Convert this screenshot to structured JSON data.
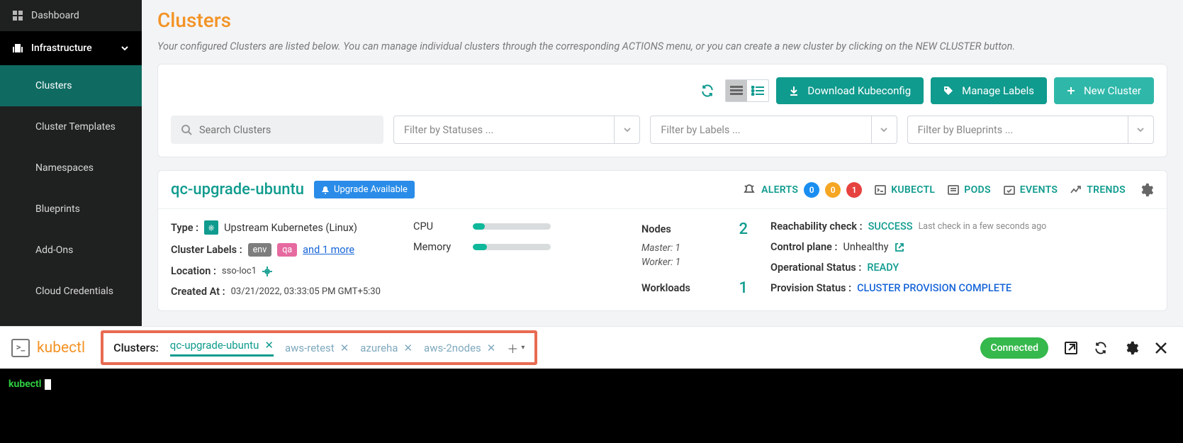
{
  "sidebar": {
    "dashboard": "Dashboard",
    "infrastructure": "Infrastructure",
    "items": [
      "Clusters",
      "Cluster Templates",
      "Namespaces",
      "Blueprints",
      "Add-Ons",
      "Cloud Credentials"
    ]
  },
  "page": {
    "title": "Clusters",
    "description": "Your configured Clusters are listed below. You can manage individual clusters through the corresponding ACTIONS menu, or you can create a new cluster by clicking on the NEW CLUSTER button."
  },
  "toolbar": {
    "download": "Download Kubeconfig",
    "manage_labels": "Manage Labels",
    "new_cluster": "New Cluster",
    "search_placeholder": "Search Clusters",
    "filter_status": "Filter by Statuses ...",
    "filter_labels": "Filter by Labels ...",
    "filter_blueprints": "Filter by Blueprints ..."
  },
  "cluster": {
    "name": "qc-upgrade-ubuntu",
    "upgrade_text": "Upgrade Available",
    "header": {
      "alerts_label": "ALERTS",
      "alerts": {
        "blue": "0",
        "orange": "0",
        "red": "1"
      },
      "links": {
        "kubectl": "KUBECTL",
        "pods": "PODS",
        "events": "EVENTS",
        "trends": "TRENDS"
      }
    },
    "type_label": "Type",
    "type_value": "Upstream Kubernetes (Linux)",
    "labels_label": "Cluster Labels",
    "labels": {
      "env": "env",
      "qa": "qa",
      "more": "and 1 more"
    },
    "location_label": "Location",
    "location_value": "sso-loc1",
    "created_label": "Created At",
    "created_value": "03/21/2022, 03:33:05 PM GMT+5:30",
    "cpu_label": "CPU",
    "memory_label": "Memory",
    "nodes_label": "Nodes",
    "nodes_value": "2",
    "master_label": "Master: 1",
    "worker_label": "Worker: 1",
    "workloads_label": "Workloads",
    "workloads_value": "1",
    "reach_label": "Reachability check",
    "reach_value": "SUCCESS",
    "reach_note": "Last check in a few seconds ago",
    "control_label": "Control plane",
    "control_value": "Unhealthy",
    "op_label": "Operational Status",
    "op_value": "READY",
    "prov_label": "Provision Status",
    "prov_value": "CLUSTER PROVISION COMPLETE"
  },
  "kubectl_bar": {
    "brand": "kubectl",
    "clusters_label": "Clusters:",
    "tabs": [
      "qc-upgrade-ubuntu",
      "aws-retest",
      "azureha",
      "aws-2nodes"
    ],
    "connected": "Connected"
  },
  "terminal": {
    "prompt": "kubectl"
  }
}
